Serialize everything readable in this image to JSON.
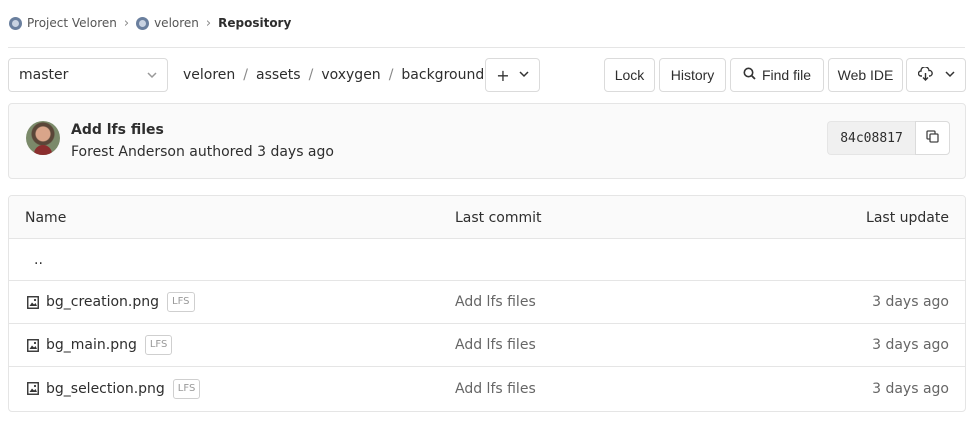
{
  "breadcrumb": {
    "items": [
      {
        "label": "Project Veloren"
      },
      {
        "label": "veloren"
      },
      {
        "label": "Repository"
      }
    ],
    "separator": "›"
  },
  "toolbar": {
    "branch": "master",
    "path": [
      "veloren",
      "assets",
      "voxygen",
      "background"
    ],
    "path_separator": "/",
    "add_label": "+",
    "lock_label": "Lock",
    "history_label": "History",
    "find_file_label": "Find file",
    "web_ide_label": "Web IDE"
  },
  "commit": {
    "title": "Add lfs files",
    "meta": "Forest Anderson authored 3 days ago",
    "sha": "84c08817"
  },
  "table": {
    "headers": {
      "name": "Name",
      "last_commit": "Last commit",
      "last_update": "Last update"
    },
    "parent_dir": "..",
    "rows": [
      {
        "name": "bg_creation.png",
        "badge": "LFS",
        "commit": "Add lfs files",
        "updated": "3 days ago"
      },
      {
        "name": "bg_main.png",
        "badge": "LFS",
        "commit": "Add lfs files",
        "updated": "3 days ago"
      },
      {
        "name": "bg_selection.png",
        "badge": "LFS",
        "commit": "Add lfs files",
        "updated": "3 days ago"
      }
    ]
  },
  "icons": {
    "project_logo": "project-logo-icon",
    "chevron": "chevron-down-icon",
    "search": "search-icon",
    "download": "download-icon",
    "copy": "copy-icon",
    "file_image": "file-image-icon"
  },
  "colors": {
    "border": "#e5e5e5",
    "subtle_bg": "#fafafa",
    "text": "#2e2e2e",
    "muted_text": "#666666"
  }
}
